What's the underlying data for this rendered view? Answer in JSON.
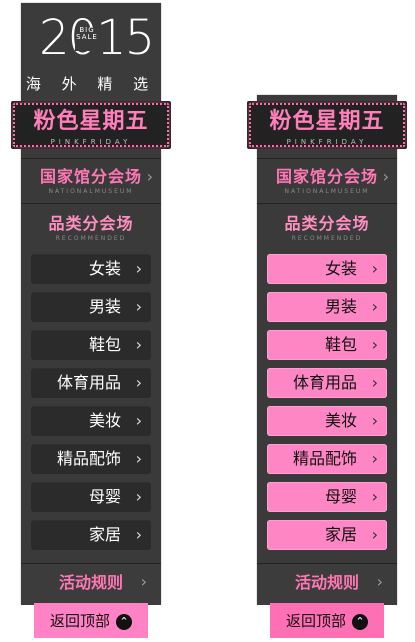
{
  "left_panel": {
    "logo": {
      "year": "2015",
      "badge_line1": "BIG",
      "badge_line2": "SALE",
      "subtitle": "海 外 精 选"
    },
    "banner": {
      "title": "粉色星期五",
      "subtitle": "PINKFRIDAY"
    },
    "museum": {
      "title": "国家馆分会场",
      "subtitle": "NATIONALMUSEUM",
      "arrow": "›"
    },
    "recommended": {
      "title": "品类分会场",
      "subtitle": "RECOMMENDED"
    },
    "menu_items": [
      "女装",
      "男装",
      "鞋包",
      "体育用品",
      "美妆",
      "精品配饰",
      "母婴",
      "家居"
    ],
    "rules": {
      "title": "活动规则",
      "arrow": "›"
    },
    "back_to_top": {
      "label": "返回顶部",
      "icon": "⌃"
    }
  },
  "right_panel": {
    "banner": {
      "title": "粉色星期五",
      "subtitle": "PINKFRIDAY"
    },
    "museum": {
      "title": "国家馆分会场",
      "subtitle": "NATIONALMUSEUM",
      "arrow": "›"
    },
    "recommended": {
      "title": "品类分会场",
      "subtitle": "RECOMMENDED"
    },
    "menu_items": [
      "女装",
      "男装",
      "鞋包",
      "体育用品",
      "美妆",
      "精品配饰",
      "母婴",
      "家居"
    ],
    "rules": {
      "title": "活动规则",
      "arrow": "›"
    },
    "back_to_top": {
      "label": "返回顶部",
      "icon": "⌃"
    }
  },
  "theme": {
    "pink": "#ff77b5",
    "pink_light": "#ff86c4",
    "pink_bright": "#ff6fb3",
    "panel_dark": "#3a3a3a",
    "button_dark": "#2b2b2b",
    "banner_dark": "#222222"
  }
}
